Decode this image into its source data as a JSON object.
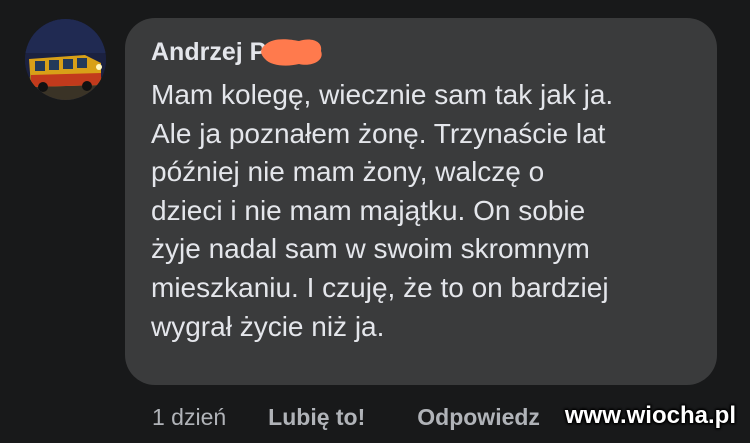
{
  "comment": {
    "author": "Andrzej P",
    "avatar_icon": "avatar-bus-photo-icon",
    "message_lines": [
      "Mam kolegę, wiecznie sam tak jak ja.",
      "Ale ja poznałem żonę. Trzynaście lat",
      "później nie mam żony, walczę o",
      "dzieci i nie mam majątku. On sobie",
      "żyje nadal sam w swoim skromnym",
      "mieszkaniu. I czuję, że to on bardziej",
      "wygrał życie niż ja."
    ],
    "redaction_color": "#ff7a4d"
  },
  "actions": {
    "timestamp": "1 dzień",
    "like_label": "Lubię to!",
    "reply_label": "Odpowiedz"
  },
  "watermark": "www.wiocha.pl",
  "colors": {
    "background": "#18191a",
    "bubble": "#3a3b3c",
    "text": "#e4e6eb",
    "secondary_text": "#b0b3b8"
  }
}
